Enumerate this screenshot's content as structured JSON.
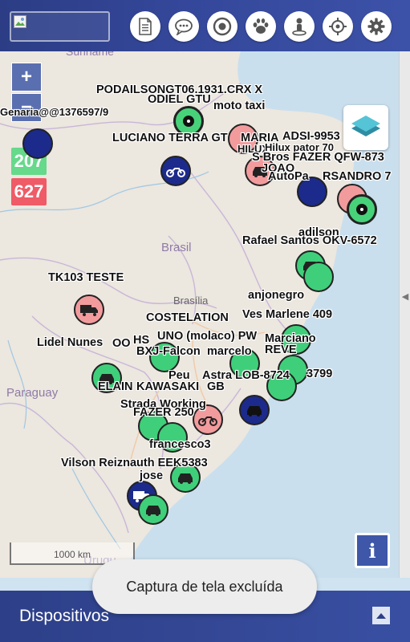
{
  "toolbar": {
    "buttons": [
      {
        "icon": "document-icon"
      },
      {
        "icon": "chat-icon"
      },
      {
        "icon": "target-icon"
      },
      {
        "icon": "paw-icon"
      },
      {
        "icon": "person-icon"
      },
      {
        "icon": "crosshair-icon"
      },
      {
        "icon": "gear-icon"
      }
    ]
  },
  "map": {
    "zoom_in": "+",
    "zoom_out": "−",
    "count_online": "207",
    "count_offline": "627",
    "count_online_color": "#66d98b",
    "count_offline_color": "#ef5b66",
    "scale_label": "1000 km",
    "info_label": "i",
    "place_names": {
      "suriname": "Suriname",
      "brasil": "Brasil",
      "brasilia": "Brasília",
      "paraguay": "Paraguay",
      "uruguay": "Urugu"
    },
    "vehicle_labels": [
      "PODAILSONGT06.1931.CRX X",
      "ODIEL GTU",
      "Genaria@@1376597/9",
      "moto taxi",
      "LUCIANO TERRA GT",
      "MARIA",
      "ADSI-9953",
      "HILUX",
      "Hilux pator 70",
      "S Bros FAZER QFW-873",
      "JOAO",
      "AutoPa",
      "RSANDRO 7",
      "adilson",
      "Rafael Santos OKV-6572",
      "anjonegro",
      "TK103 TESTE",
      "Ves Marlene 409",
      "COSTELATION",
      "UNO (molaco) PW",
      "Marciano",
      "HS",
      "REVE",
      "Lidel Nunes",
      "OO",
      "BXJ-Falcon",
      "marcelo",
      "Peu",
      "Astra LOB-8724",
      "3799",
      "ELAIN",
      "KAWASAKI",
      "GB",
      "Strada Working",
      "FAZER 250",
      "francesco3",
      "Vilson Reiznauth EEK5383",
      "jose"
    ]
  },
  "toast": {
    "text": "Captura de tela excluída"
  },
  "bottom": {
    "title": "Dispositivos"
  }
}
